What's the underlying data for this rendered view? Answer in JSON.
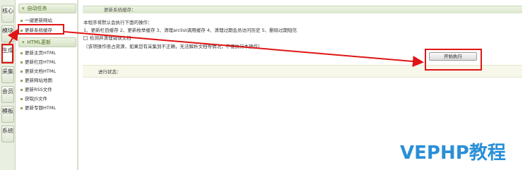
{
  "tabs": [
    {
      "label": "核心"
    },
    {
      "label": "模块"
    },
    {
      "label": "生成"
    },
    {
      "label": "采集"
    },
    {
      "label": "会员"
    },
    {
      "label": "模板"
    },
    {
      "label": "系统"
    }
  ],
  "menu": {
    "section1_title": "自动任务",
    "section1_items": [
      "一键更新网站",
      "更新系统缓存"
    ],
    "section2_title": "HTML更新",
    "section2_items": [
      "更新主页HTML",
      "更新栏目HTML",
      "更新文档HTML",
      "更新网站地图",
      "更新RSS文件",
      "获取JS文件",
      "更新专题HTML"
    ]
  },
  "main": {
    "title": "更新系统缓存：",
    "intro": "本程序将默认会执行下面的操作：",
    "steps": "1、更新栏目缓存 2、更新枚举缓存 3、清理arclist调用缓存 4、清理过期会员访问历史 5、删除过期短信",
    "checkbox_label": "检测并清理错误文档",
    "note": "（该项操作很占资源，如果您有采集到不正确，无法解析文档等情况，不要执行本操作）",
    "start_button": "开始执行",
    "progress_label": "进行状态："
  },
  "watermark": "VEPHP教程",
  "colors": {
    "annotation": "#e01515",
    "watermark": "#2a8fd6"
  }
}
